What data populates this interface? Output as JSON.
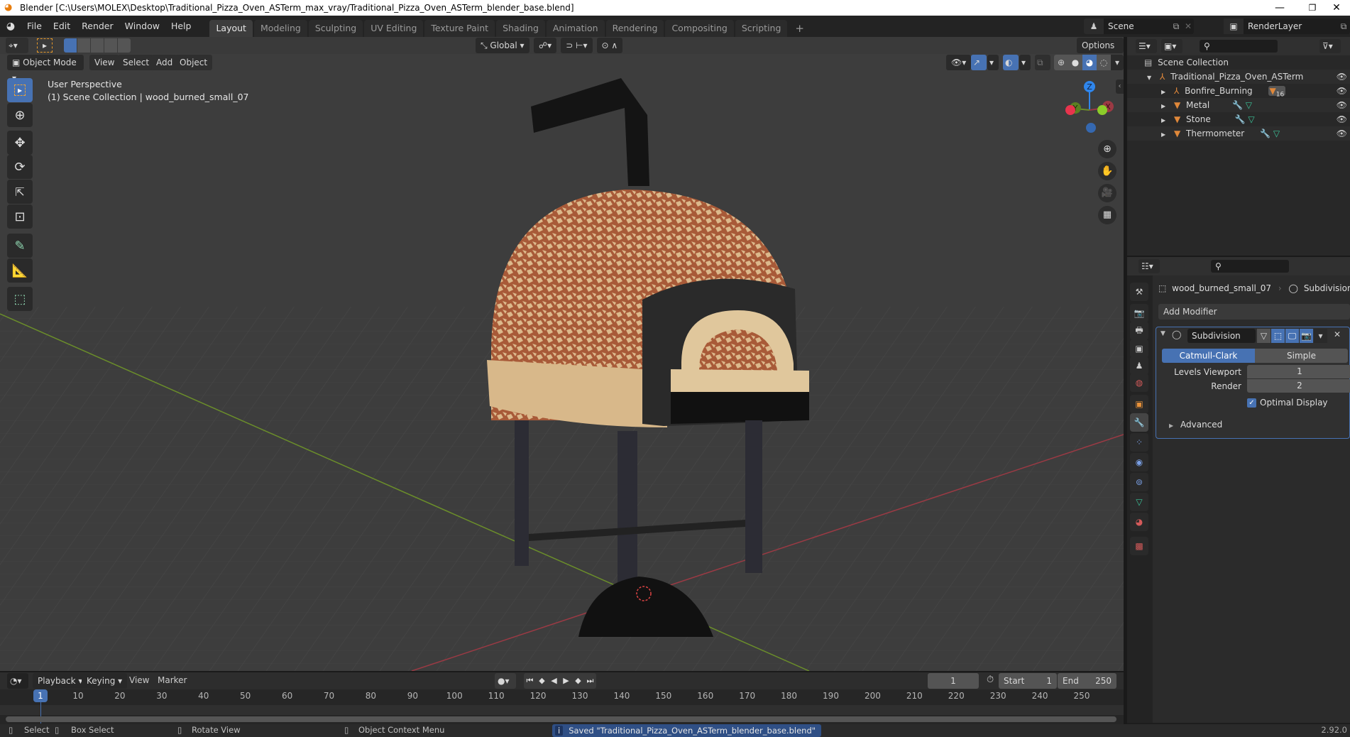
{
  "window": {
    "title": "Blender [C:\\Users\\MOLEX\\Desktop\\Traditional_Pizza_Oven_ASTerm_max_vray/Traditional_Pizza_Oven_ASTerm_blender_base.blend]",
    "minimize": "—",
    "maximize": "❐",
    "close": "✕"
  },
  "menu": [
    "File",
    "Edit",
    "Render",
    "Window",
    "Help"
  ],
  "workspaces": [
    {
      "label": "Layout",
      "active": true
    },
    {
      "label": "Modeling"
    },
    {
      "label": "Sculpting"
    },
    {
      "label": "UV Editing"
    },
    {
      "label": "Texture Paint"
    },
    {
      "label": "Shading"
    },
    {
      "label": "Animation"
    },
    {
      "label": "Rendering"
    },
    {
      "label": "Compositing"
    },
    {
      "label": "Scripting"
    }
  ],
  "add_workspace": "+",
  "scene": {
    "name": "Scene",
    "view_layer": "RenderLayer"
  },
  "viewport": {
    "options_label": "Options",
    "transform_orientation": "Global",
    "mode": "Object Mode",
    "header_menus": [
      "View",
      "Select",
      "Add",
      "Object"
    ],
    "overlay_line1": "User Perspective",
    "overlay_line2": "(1) Scene Collection | wood_burned_small_07",
    "gizmo_axes": {
      "z": "Z",
      "y": "Y",
      "x": "X"
    },
    "shading_mode": "solid-material-preview"
  },
  "outliner": {
    "root": "Scene Collection",
    "items": [
      {
        "name": "Traditional_Pizza_Oven_ASTerm",
        "type": "empty",
        "level": 1,
        "expanded": true
      },
      {
        "name": "Bonfire_Burning",
        "type": "empty",
        "level": 2,
        "badge": "16"
      },
      {
        "name": "Metal",
        "type": "mesh",
        "level": 2
      },
      {
        "name": "Stone",
        "type": "mesh",
        "level": 2
      },
      {
        "name": "Thermometer",
        "type": "mesh",
        "level": 2
      }
    ]
  },
  "properties": {
    "breadcrumb_object": "wood_burned_small_07",
    "breadcrumb_modifier": "Subdivision",
    "add_modifier": "Add Modifier",
    "modifier": {
      "name": "Subdivision",
      "algorithms": [
        {
          "label": "Catmull-Clark",
          "active": true
        },
        {
          "label": "Simple"
        }
      ],
      "levels_viewport_label": "Levels Viewport",
      "levels_viewport": "1",
      "render_label": "Render",
      "render": "2",
      "optimal_display_label": "Optimal Display",
      "optimal_display": true,
      "advanced_label": "Advanced"
    }
  },
  "timeline": {
    "menus": [
      "Playback",
      "Keying",
      "View",
      "Marker"
    ],
    "current_frame": "1",
    "start_label": "Start",
    "start": "1",
    "end_label": "End",
    "end": "250",
    "ticks": [
      "10",
      "20",
      "30",
      "40",
      "50",
      "60",
      "70",
      "80",
      "90",
      "100",
      "110",
      "120",
      "130",
      "140",
      "150",
      "160",
      "170",
      "180",
      "190",
      "200",
      "210",
      "220",
      "230",
      "240",
      "250"
    ]
  },
  "statusbar": {
    "select": "Select",
    "box_select": "Box Select",
    "rotate_view": "Rotate View",
    "context_menu": "Object Context Menu",
    "report": "Saved \"Traditional_Pizza_Oven_ASTerm_blender_base.blend\"",
    "version": "2.92.0"
  },
  "colors": {
    "accent": "#4772b3",
    "object_orange": "#e0883a",
    "mesh_green": "#3bc59a",
    "axis_x": "#e8344d",
    "axis_y": "#8ccc2a",
    "axis_z": "#2f86ec"
  }
}
